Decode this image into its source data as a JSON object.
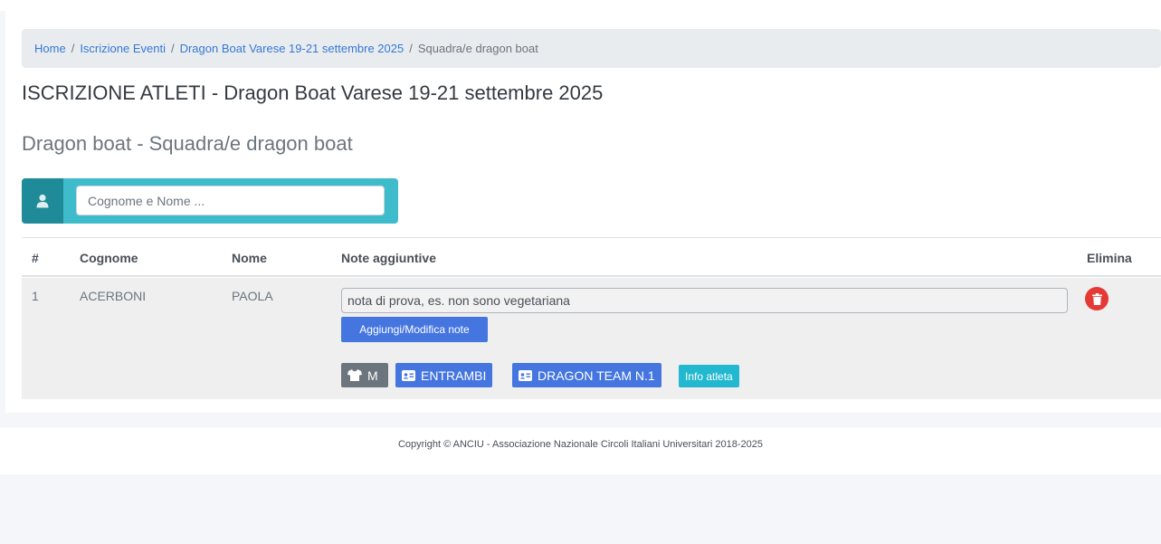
{
  "breadcrumb": {
    "items": [
      "Home",
      "Iscrizione Eventi",
      "Dragon Boat Varese 19-21 settembre 2025"
    ],
    "current": "Squadra/e dragon boat",
    "separator": "/"
  },
  "page": {
    "title": "ISCRIZIONE ATLETI - Dragon Boat Varese 19-21 settembre 2025",
    "subtitle": "Dragon boat - Squadra/e dragon boat"
  },
  "search": {
    "placeholder": "Cognome e Nome ..."
  },
  "table": {
    "headers": {
      "num": "#",
      "cognome": "Cognome",
      "nome": "Nome",
      "note": "Note aggiuntive",
      "elimina": "Elimina"
    },
    "rows": [
      {
        "num": "1",
        "cognome": "ACERBONI",
        "nome": "PAOLA",
        "note_value": "nota di prova, es. non sono vegetariana",
        "note_button": "Aggiungi/Modifica note",
        "shirt_size": "M",
        "badge_partecipazione": "ENTRAMBI",
        "badge_team": "DRAGON TEAM N.1",
        "info_button": "Info atleta"
      }
    ]
  },
  "footer": {
    "copyright": "Copyright © ANCIU - Associazione Nazionale Circoli Italiani Universitari 2018-2025"
  },
  "colors": {
    "link": "#3478d4",
    "primary": "#4576e0",
    "info": "#22b8cf",
    "search_bg": "#3fbccb",
    "search_icon_bg": "#1f8a98",
    "danger": "#e53935",
    "secondary": "#6c757d"
  },
  "icons": {
    "search": "user-icon",
    "shirt": "tshirt-icon",
    "id_card": "id-card-icon",
    "delete": "trash-icon"
  }
}
